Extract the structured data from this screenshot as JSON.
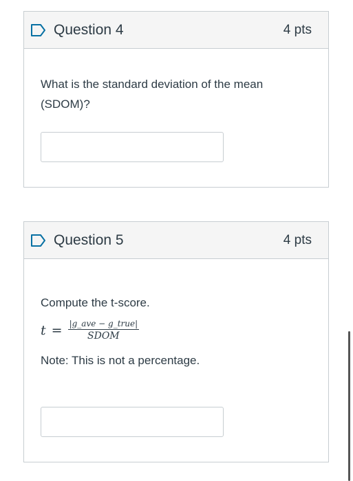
{
  "questions": [
    {
      "title": "Question 4",
      "points": "4 pts",
      "text": "What is the standard deviation of the mean (SDOM)?",
      "answer_value": ""
    },
    {
      "title": "Question 5",
      "points": "4 pts",
      "text": "Compute the t-score.",
      "formula": {
        "lhs": "t",
        "eq": "=",
        "numerator": "|g_ave − g_true|",
        "denominator": "SDOM"
      },
      "note": "Note: This is not a percentage.",
      "answer_value": ""
    }
  ],
  "icons": {
    "flag": "flag-icon"
  },
  "colors": {
    "text": "#2d3b45",
    "border": "#c7cdd1",
    "header_bg": "#f5f5f5",
    "flag": "#0770a3"
  }
}
